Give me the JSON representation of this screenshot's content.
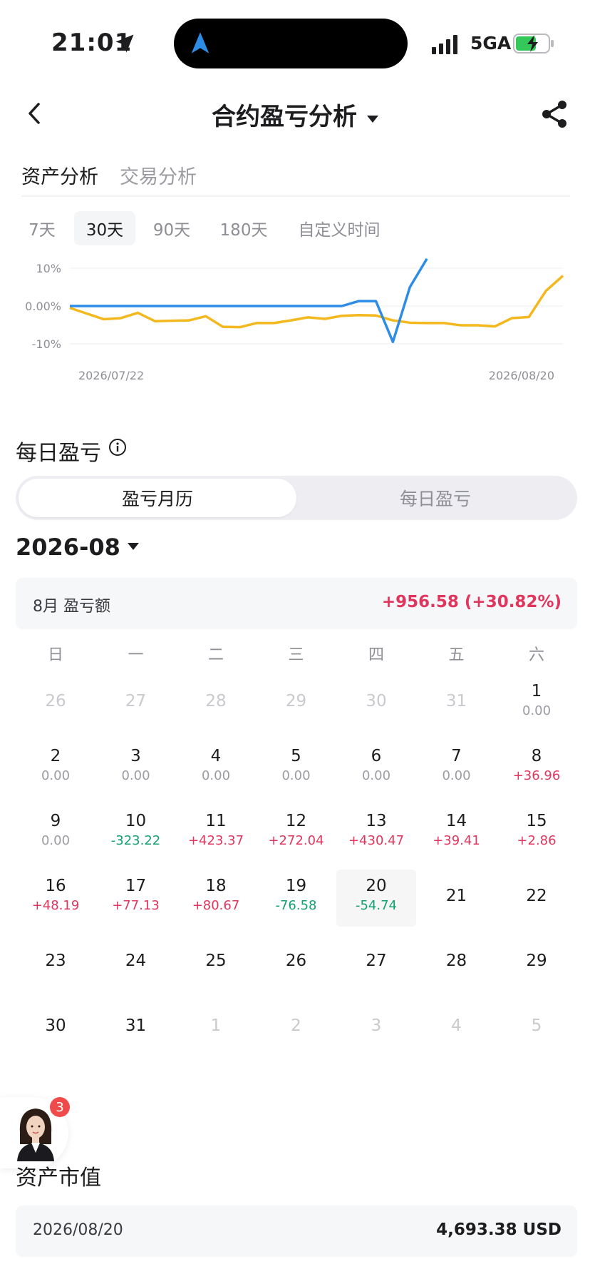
{
  "status_bar": {
    "time": "21:01",
    "network": "5GA"
  },
  "header": {
    "title": "合约盈亏分析"
  },
  "main_tabs": [
    {
      "label": "资产分析",
      "active": true
    },
    {
      "label": "交易分析",
      "active": false
    }
  ],
  "periods": [
    {
      "label": "7天",
      "active": false
    },
    {
      "label": "30天",
      "active": true
    },
    {
      "label": "90天",
      "active": false
    },
    {
      "label": "180天",
      "active": false
    },
    {
      "label": "自定义时间",
      "active": false
    }
  ],
  "chart_data": {
    "type": "line",
    "y_ticks": [
      "10%",
      "0.00%",
      "-10%"
    ],
    "x_labels": [
      "2026/07/22",
      "2026/08/20"
    ],
    "ylim": [
      -10,
      10
    ],
    "series": [
      {
        "color": "#f2b81d",
        "values": [
          -0.5,
          -2.0,
          -3.5,
          -3.2,
          -1.8,
          -4.0,
          -3.9,
          -3.8,
          -2.7,
          -5.5,
          -5.6,
          -4.5,
          -4.5,
          -3.8,
          -3.0,
          -3.4,
          -2.6,
          -2.4,
          -2.5,
          -3.8,
          -4.4,
          -4.5,
          -4.5,
          -5.1,
          -5.1,
          -5.4,
          -3.2,
          -2.9,
          4.0,
          8.0
        ]
      },
      {
        "color": "#2d8ce6",
        "values": [
          0.0,
          0.0,
          0.0,
          0.0,
          0.0,
          0.0,
          0.0,
          0.0,
          0.0,
          0.0,
          0.0,
          0.0,
          0.0,
          0.0,
          0.0,
          0.0,
          0.0,
          1.3,
          1.3,
          -9.5,
          5.0,
          12.5
        ]
      }
    ]
  },
  "daily_pnl": {
    "title": "每日盈亏",
    "segments": [
      {
        "label": "盈亏月历",
        "active": true
      },
      {
        "label": "每日盈亏",
        "active": false
      }
    ],
    "month": "2026-08",
    "summary_label": "8月 盈亏额",
    "summary_value": "+956.58 (+30.82%)"
  },
  "weekdays": [
    "日",
    "一",
    "二",
    "三",
    "四",
    "五",
    "六"
  ],
  "calendar": [
    {
      "day": "26",
      "value": "",
      "faded": true
    },
    {
      "day": "27",
      "value": "",
      "faded": true
    },
    {
      "day": "28",
      "value": "",
      "faded": true
    },
    {
      "day": "29",
      "value": "",
      "faded": true
    },
    {
      "day": "30",
      "value": "",
      "faded": true
    },
    {
      "day": "31",
      "value": "",
      "faded": true
    },
    {
      "day": "1",
      "value": "0.00"
    },
    {
      "day": "2",
      "value": "0.00"
    },
    {
      "day": "3",
      "value": "0.00"
    },
    {
      "day": "4",
      "value": "0.00"
    },
    {
      "day": "5",
      "value": "0.00"
    },
    {
      "day": "6",
      "value": "0.00"
    },
    {
      "day": "7",
      "value": "0.00"
    },
    {
      "day": "8",
      "value": "+36.96"
    },
    {
      "day": "9",
      "value": "0.00"
    },
    {
      "day": "10",
      "value": "-323.22"
    },
    {
      "day": "11",
      "value": "+423.37"
    },
    {
      "day": "12",
      "value": "+272.04"
    },
    {
      "day": "13",
      "value": "+430.47"
    },
    {
      "day": "14",
      "value": "+39.41"
    },
    {
      "day": "15",
      "value": "+2.86"
    },
    {
      "day": "16",
      "value": "+48.19"
    },
    {
      "day": "17",
      "value": "+77.13"
    },
    {
      "day": "18",
      "value": "+80.67"
    },
    {
      "day": "19",
      "value": "-76.58"
    },
    {
      "day": "20",
      "value": "-54.74",
      "today": true
    },
    {
      "day": "21",
      "value": ""
    },
    {
      "day": "22",
      "value": ""
    },
    {
      "day": "23",
      "value": ""
    },
    {
      "day": "24",
      "value": ""
    },
    {
      "day": "25",
      "value": ""
    },
    {
      "day": "26",
      "value": ""
    },
    {
      "day": "27",
      "value": ""
    },
    {
      "day": "28",
      "value": ""
    },
    {
      "day": "29",
      "value": ""
    },
    {
      "day": "30",
      "value": ""
    },
    {
      "day": "31",
      "value": ""
    },
    {
      "day": "1",
      "value": "",
      "faded": true
    },
    {
      "day": "2",
      "value": "",
      "faded": true
    },
    {
      "day": "3",
      "value": "",
      "faded": true
    },
    {
      "day": "4",
      "value": "",
      "faded": true
    },
    {
      "day": "5",
      "value": "",
      "faded": true
    }
  ],
  "support": {
    "badge": "3"
  },
  "assets": {
    "title": "资产市值",
    "date": "2026/08/20",
    "value": "4,693.38 USD"
  },
  "colors": {
    "positive": "#e0365e",
    "negative": "#13a070",
    "accent_blue": "#2d8ce6",
    "accent_yellow": "#f2b81d"
  }
}
